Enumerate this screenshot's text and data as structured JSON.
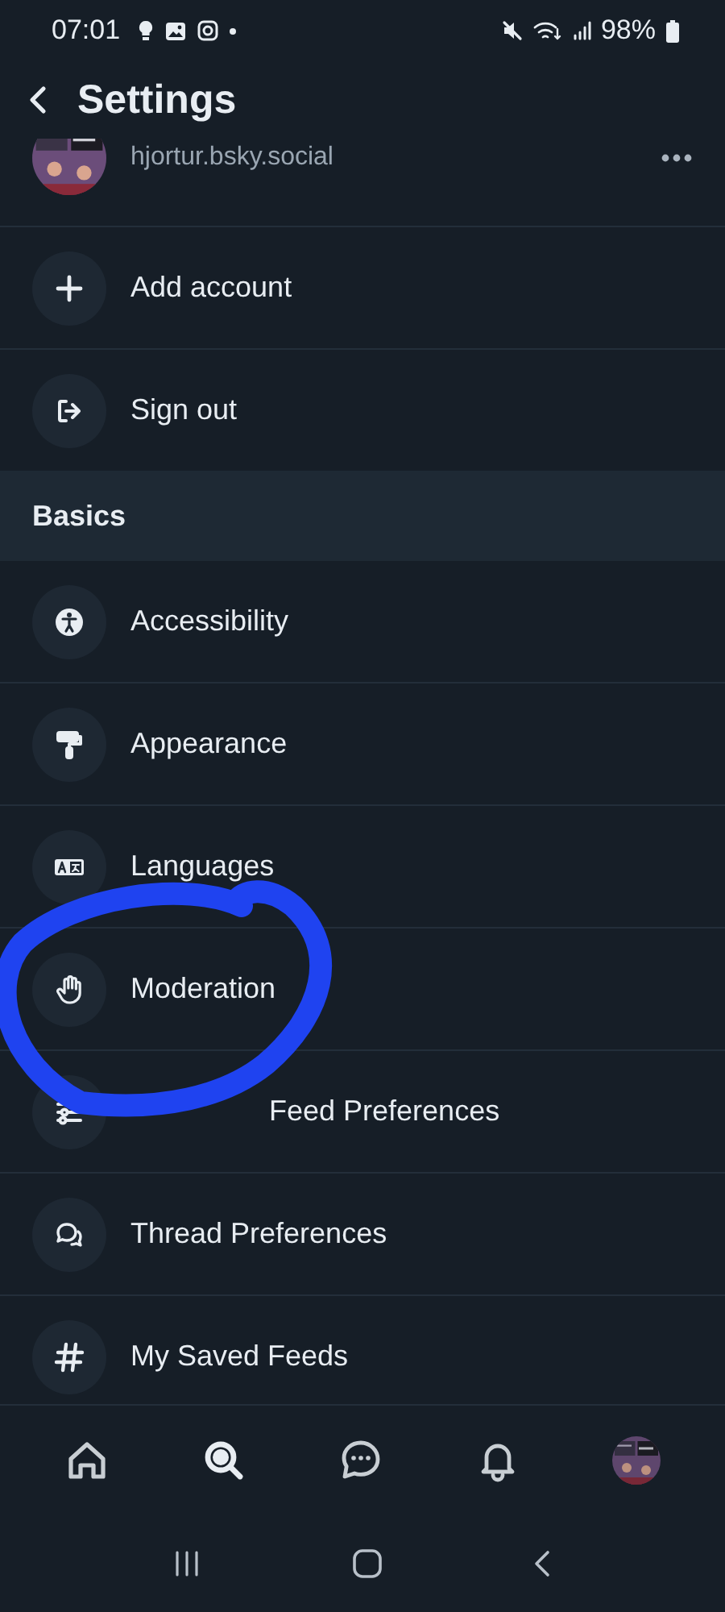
{
  "status_bar": {
    "time": "07:01",
    "battery": "98%"
  },
  "header": {
    "title": "Settings"
  },
  "account": {
    "handle": "hjortur.bsky.social"
  },
  "rows": [
    {
      "kind": "item",
      "label": "Add account"
    },
    {
      "kind": "item",
      "label": "Sign out"
    },
    {
      "kind": "section",
      "label": "Basics"
    },
    {
      "kind": "item",
      "label": "Accessibility"
    },
    {
      "kind": "item",
      "label": "Appearance"
    },
    {
      "kind": "item",
      "label": "Languages"
    },
    {
      "kind": "item",
      "label": "Moderation"
    },
    {
      "kind": "covered_item",
      "label": "Feed Preferences"
    },
    {
      "kind": "item",
      "label": "Thread Preferences"
    },
    {
      "kind": "item",
      "label": "My Saved Feeds"
    }
  ],
  "tab_bar": {
    "tabs": [
      {
        "kind": "home",
        "selected": false
      },
      {
        "kind": "search",
        "selected": true
      },
      {
        "kind": "chat",
        "selected": false
      },
      {
        "kind": "bell",
        "selected": false
      },
      {
        "kind": "avatar",
        "selected": false
      }
    ]
  }
}
